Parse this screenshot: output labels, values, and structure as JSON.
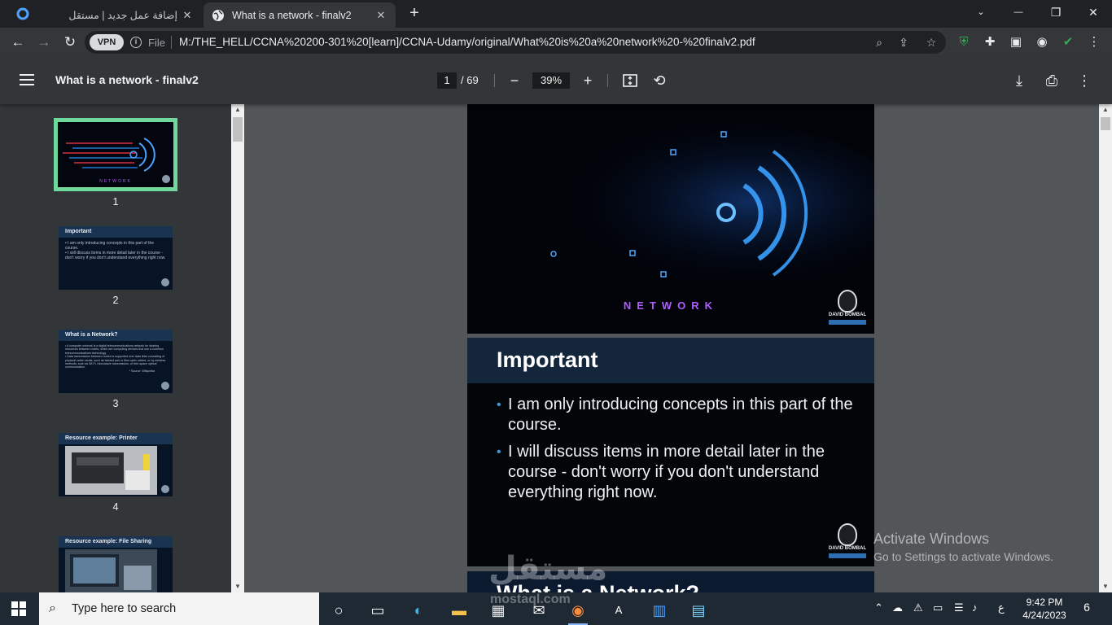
{
  "browser": {
    "tabs": [
      {
        "title": "إضافة عمل جديد | مستقل",
        "active": false
      },
      {
        "title": "What is a network - finalv2",
        "active": true
      }
    ],
    "new_tab": "+",
    "window_controls": {
      "minimize": "—",
      "maximize": "❐",
      "close": "✕"
    }
  },
  "address_bar": {
    "vpn_label": "VPN",
    "scheme_label": "File",
    "url": "M:/THE_HELL/CCNA%20200-301%20[learn]/CCNA-Udamy/original/What%20is%20a%20network%20-%20finalv2.pdf"
  },
  "pdf_toolbar": {
    "title": "What is a network - finalv2",
    "current_page": "1",
    "total_pages": "/ 69",
    "zoom": "39%"
  },
  "thumbnails": [
    {
      "number": "1",
      "title": "NETWORK",
      "body": []
    },
    {
      "number": "2",
      "title": "Important",
      "body": [
        "• I am only introducing concepts in this part of the course.",
        "• I will discuss items in more detail later in the course - don't worry if you don't understand everything right now."
      ]
    },
    {
      "number": "3",
      "title": "What is a Network?",
      "body": [
        "• A computer network is a digital telecommunications network for sharing resources between nodes, which are computing devices that use a common telecommunications technology.",
        "• Data transmission between nodes is supported over data links consisting of physical cable media, such as twisted pair or fibre-optic cables, or by wireless methods, such as Wi-Fi, microwave transmission, or free-space optical communication.",
        "* Source: Wikipedia"
      ]
    },
    {
      "number": "4",
      "title": "Resource example: Printer",
      "body": []
    },
    {
      "number": "5",
      "title": "Resource example: File Sharing",
      "body": []
    }
  ],
  "slides": {
    "slide1": {
      "word": "NETWORK",
      "logo_name": "DAVID BOMBAL"
    },
    "slide2": {
      "title": "Important",
      "bullets": [
        "I am only introducing concepts in this part of the course.",
        "I will discuss items in more detail later in the course - don't worry if you don't understand everything right now."
      ],
      "logo_name": "DAVID BOMBAL"
    },
    "slide3": {
      "title": "What is a Network?"
    }
  },
  "activation": {
    "line1": "Activate Windows",
    "line2": "Go to Settings to activate Windows."
  },
  "watermark": {
    "arabic": "مستقل",
    "latin": "mostaql.com"
  },
  "taskbar": {
    "search_placeholder": "Type here to search",
    "time": "9:42 PM",
    "date": "4/24/2023",
    "lang": "ع",
    "notification_count": "6"
  },
  "colors": {
    "selected_thumb_border": "#6fd89a",
    "pdf_toolbar": "#323639",
    "viewer_bg": "#525659",
    "slide_header": "#13263c",
    "bullet": "#3c9bd8",
    "network_word": "#b05cff"
  }
}
